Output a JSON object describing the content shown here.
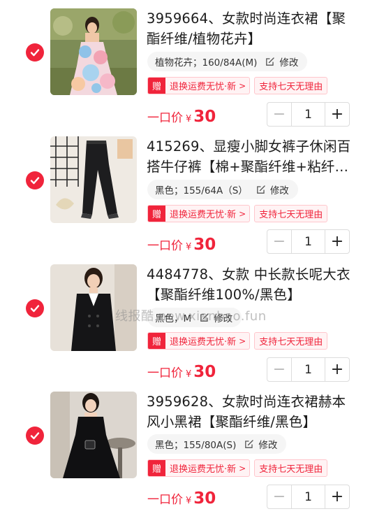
{
  "colors": {
    "accent": "#f0243b",
    "tag_bg": "#fff3f4",
    "sku_bg": "#f5f5f5"
  },
  "items": [
    {
      "title": "3959664、女款时尚连衣裙【聚酯纤维/植物花卉】",
      "sku": "植物花卉；160/84A(M)",
      "edit_label": "修改",
      "tag_badge": "赠",
      "tag_text": "退换运费无忧·新",
      "tag_arrow": ">",
      "return_tag": "支持七天无理由",
      "price_label": "一口价",
      "currency": "¥",
      "price": "30",
      "qty": "1",
      "minus": "−",
      "plus": "+",
      "image_icon": "floral-dress-photo"
    },
    {
      "title": "415269、显瘦小脚女裤子休闲百搭牛仔裤【棉+聚酯纤维+粘纤…",
      "sku": "黑色；155/64A（S）",
      "edit_label": "修改",
      "tag_badge": "赠",
      "tag_text": "退换运费无忧·新",
      "tag_arrow": ">",
      "return_tag": "支持七天无理由",
      "price_label": "一口价",
      "currency": "¥",
      "price": "30",
      "qty": "1",
      "minus": "−",
      "plus": "+",
      "image_icon": "black-jeans-photo"
    },
    {
      "title": "4484778、女款 中长款长呢大衣【聚酯纤维100%/黑色】",
      "sku": "黑色，M",
      "edit_label": "修改",
      "tag_badge": "赠",
      "tag_text": "退换运费无忧·新",
      "tag_arrow": ">",
      "return_tag": "支持七天无理由",
      "price_label": "一口价",
      "currency": "¥",
      "price": "30",
      "qty": "1",
      "minus": "−",
      "plus": "+",
      "image_icon": "black-coat-photo"
    },
    {
      "title": "3959628、女款时尚连衣裙赫本风小黑裙【聚酯纤维/黑色】",
      "sku": "黑色；155/80A(S)",
      "edit_label": "修改",
      "tag_badge": "赠",
      "tag_text": "退换运费无忧·新",
      "tag_arrow": ">",
      "return_tag": "支持七天无理由",
      "price_label": "一口价",
      "currency": "¥",
      "price": "30",
      "qty": "1",
      "minus": "−",
      "plus": "+",
      "image_icon": "black-dress-photo"
    }
  ],
  "watermark": "线报酷 new.xianbao.fun"
}
